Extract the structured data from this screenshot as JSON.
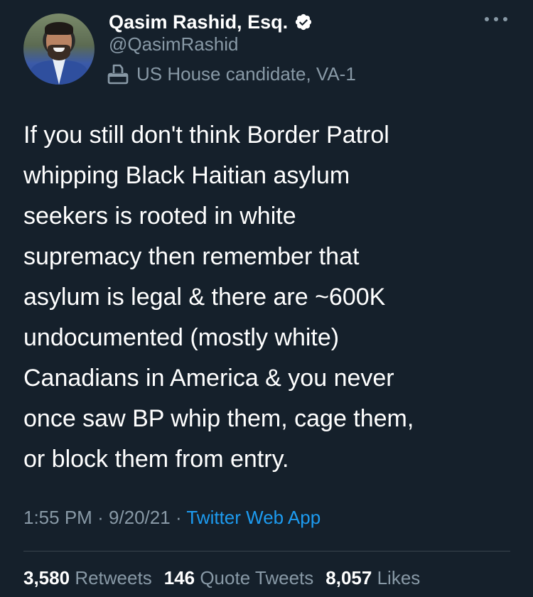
{
  "author": {
    "name": "Qasim Rashid, Esq.",
    "handle": "@QasimRashid",
    "label": "US House candidate, VA-1",
    "verified_icon": "verified-badge-icon",
    "label_icon": "ballot-box-icon"
  },
  "tweet": {
    "lines": [
      "If you still don't think Border Patrol",
      "whipping Black Haitian asylum",
      "seekers is rooted in white",
      "supremacy then remember that",
      "asylum is legal & there are ~600K",
      "undocumented (mostly white)",
      "Canadians in America & you never",
      "once saw BP whip them, cage them,",
      "or block them from entry."
    ],
    "time": "1:55 PM",
    "date": "9/20/21",
    "source": "Twitter Web App"
  },
  "stats": {
    "retweets_count": "3,580",
    "retweets_label": "Retweets",
    "quotes_count": "146",
    "quotes_label": "Quote Tweets",
    "likes_count": "8,057",
    "likes_label": "Likes"
  },
  "colors": {
    "background": "#15202b",
    "text": "#ffffff",
    "secondary": "#8899a6",
    "link": "#1d9bf0",
    "divider": "#38444d"
  }
}
